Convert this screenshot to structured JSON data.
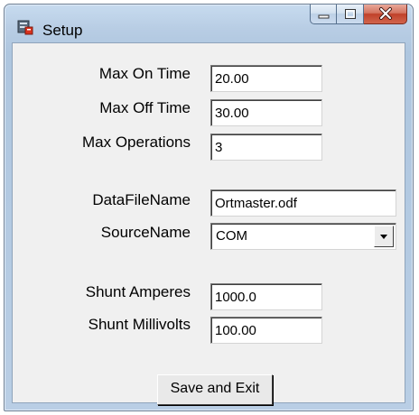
{
  "window": {
    "title": "Setup",
    "icons": {
      "app": "setup-app-icon",
      "minimize": "minimize-icon",
      "maximize": "maximize-icon",
      "close": "close-icon"
    }
  },
  "form": {
    "max_on_time": {
      "label": "Max On Time",
      "value": "20.00"
    },
    "max_off_time": {
      "label": "Max Off Time",
      "value": "30.00"
    },
    "max_operations": {
      "label": "Max Operations",
      "value": "3"
    },
    "data_file_name": {
      "label": "DataFileName",
      "value": "Ortmaster.odf"
    },
    "source_name": {
      "label": "SourceName",
      "value": "COM"
    },
    "shunt_amperes": {
      "label": "Shunt Amperes",
      "value": "1000.0"
    },
    "shunt_millivolts": {
      "label": "Shunt Millivolts",
      "value": "100.00"
    }
  },
  "actions": {
    "save_exit_label": "Save and Exit"
  },
  "colors": {
    "client_bg": "#f0f0f0",
    "close_button": "#c0412a"
  }
}
